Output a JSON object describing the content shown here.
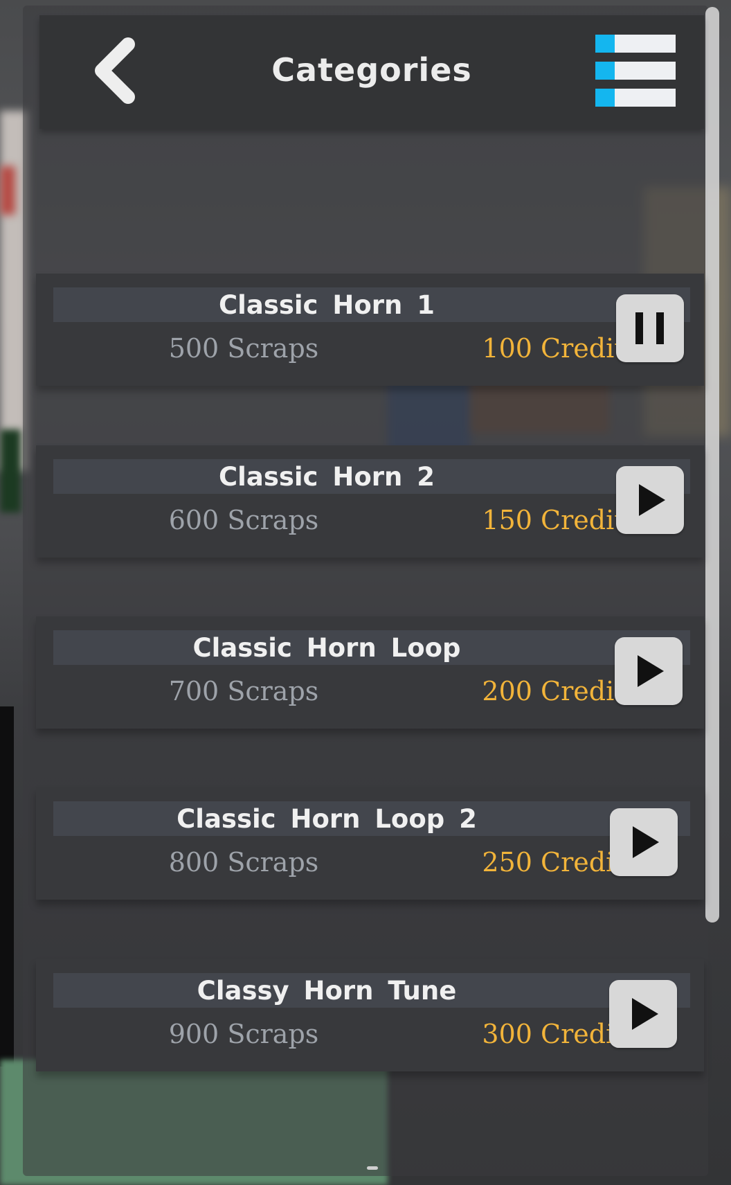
{
  "header": {
    "title": "Categories",
    "back_icon": "chevron-left-icon",
    "menu_icon": "hamburger-menu-icon",
    "accent_color": "#14b6ef"
  },
  "items": [
    {
      "name": "Classic Horn 1",
      "scraps": "500 Scraps",
      "credits": "100 Credits",
      "state": "pause",
      "icon": "pause-icon"
    },
    {
      "name": "Classic Horn 2",
      "scraps": "600 Scraps",
      "credits": "150 Credits",
      "state": "play",
      "icon": "play-icon"
    },
    {
      "name": "Classic Horn Loop",
      "scraps": "700 Scraps",
      "credits": "200 Credits",
      "state": "play",
      "icon": "play-icon"
    },
    {
      "name": "Classic Horn Loop 2",
      "scraps": "800 Scraps",
      "credits": "250 Credits",
      "state": "play",
      "icon": "play-icon"
    },
    {
      "name": "Classy Horn Tune",
      "scraps": "900 Scraps",
      "credits": "300 Credits",
      "state": "play",
      "icon": "play-icon"
    }
  ],
  "colors": {
    "credits": "#f2b43a",
    "scraps": "#9ea3aa",
    "button": "#d8d8d8"
  }
}
